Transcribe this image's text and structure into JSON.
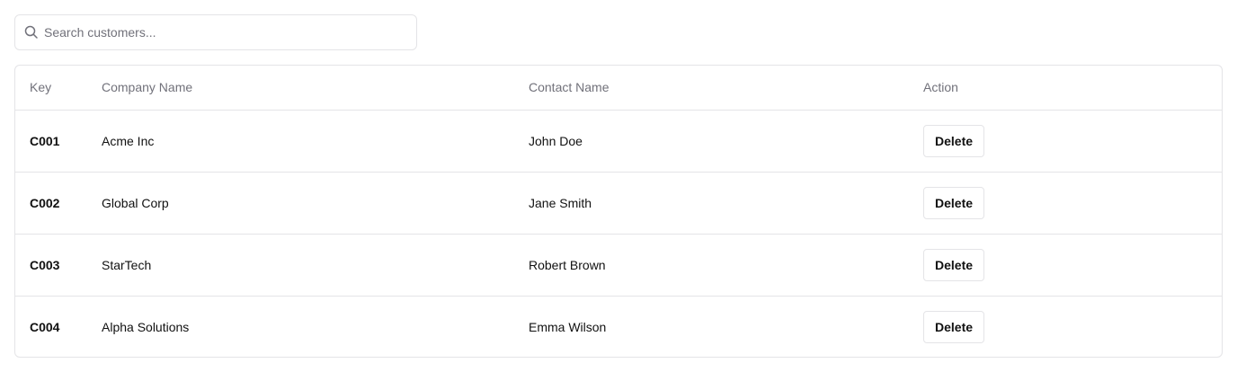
{
  "search": {
    "placeholder": "Search customers...",
    "value": "",
    "icon": "search-icon"
  },
  "table": {
    "columns": {
      "key": "Key",
      "company": "Company Name",
      "contact": "Contact Name",
      "action": "Action"
    },
    "rows": [
      {
        "key": "C001",
        "company": "Acme Inc",
        "contact": "John Doe",
        "action_label": "Delete"
      },
      {
        "key": "C002",
        "company": "Global Corp",
        "contact": "Jane Smith",
        "action_label": "Delete"
      },
      {
        "key": "C003",
        "company": "StarTech",
        "contact": "Robert Brown",
        "action_label": "Delete"
      },
      {
        "key": "C004",
        "company": "Alpha Solutions",
        "contact": "Emma Wilson",
        "action_label": "Delete"
      }
    ]
  },
  "colors": {
    "border": "#e4e4e7",
    "muted_text": "#71717a",
    "text": "#111111",
    "background": "#ffffff"
  }
}
